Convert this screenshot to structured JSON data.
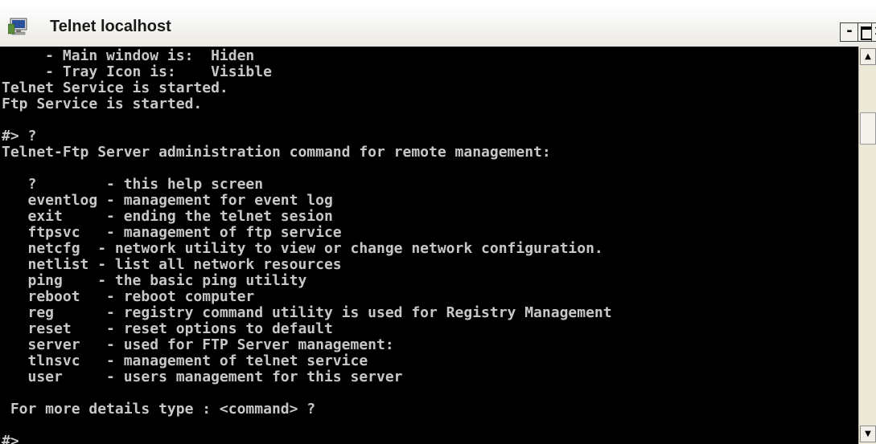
{
  "window": {
    "title": "Telnet localhost",
    "icon": "telnet-console-icon",
    "controls": {
      "minimize": "-",
      "maximize": "maximize-icon",
      "close": "×"
    }
  },
  "console": {
    "lines": [
      "     - Main window is:  Hiden",
      "     - Tray Icon is:    Visible",
      "Telnet Service is started.",
      "Ftp Service is started.",
      "",
      "#> ?",
      "Telnet-Ftp Server administration command for remote management:",
      "",
      "   ?        - this help screen",
      "   eventlog - management for event log",
      "   exit     - ending the telnet sesion",
      "   ftpsvc   - management of ftp service",
      "   netcfg  - network utility to view or change network configuration.",
      "   netlist - list all network resources",
      "   ping    - the basic ping utility",
      "   reboot   - reboot computer",
      "   reg      - registry command utility is used for Registry Management",
      "   reset    - reset options to default",
      "   server   - used for FTP Server management:",
      "   tlnsvc   - management of telnet service",
      "   user     - users management for this server",
      "",
      " For more details type : <command> ?",
      "",
      "#> "
    ],
    "text_color": "#c7c7c7",
    "background": "#000000"
  },
  "scrollbar": {
    "up_icon": "scroll-up-arrow-icon",
    "down_icon": "scroll-down-arrow-icon"
  }
}
